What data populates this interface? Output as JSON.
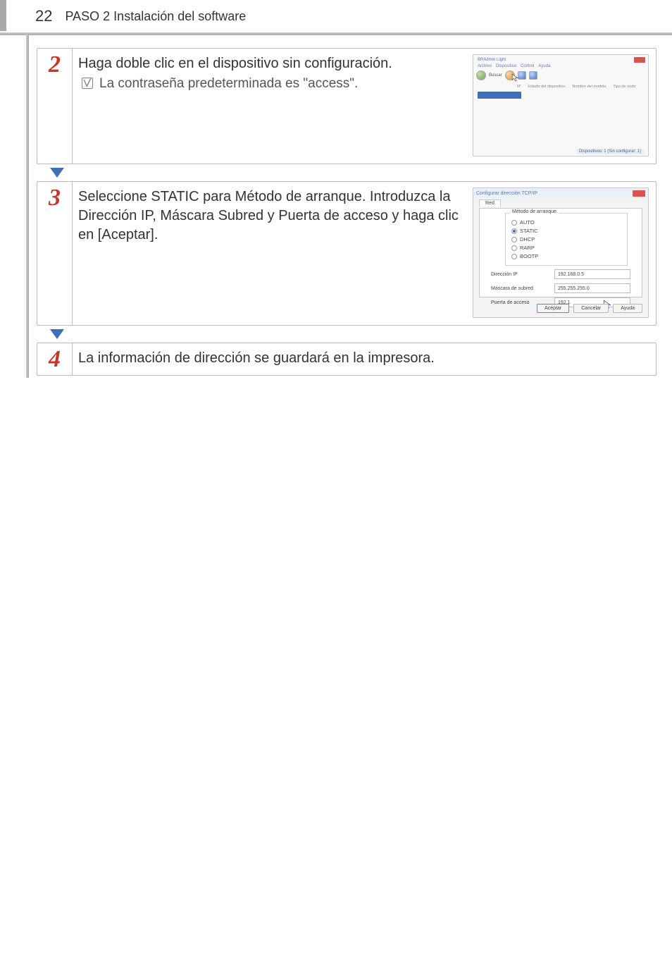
{
  "page": {
    "number": "22",
    "breadcrumb": "PASO 2 Instalación del software"
  },
  "steps": [
    {
      "num": "2",
      "text": "Haga doble clic en el dispositivo sin configuración.",
      "note": "La contraseña predeterminada es \"access\"."
    },
    {
      "num": "3",
      "text": "Seleccione STATIC para Método de arranque. Introduzca la Dirección IP, Máscara Subred y Puerta de acceso y haga clic en [Aceptar]."
    },
    {
      "num": "4",
      "text": "La información de dirección se guardará en la impresora."
    }
  ],
  "thumb1": {
    "window_title": "BRAdmin Light",
    "menu": [
      "Archivo",
      "Dispositivo",
      "Control",
      "Ayuda"
    ],
    "toolbar_label": "Buscar",
    "headers": [
      "IP",
      "Estado del dispositivo",
      "Nombre del modelo",
      "Tipo de nodo"
    ],
    "status": "Dispositivos: 1 (Sin configurar: 1)"
  },
  "thumb2": {
    "title": "Configurar dirección TCP/IP",
    "tab": "Red",
    "group": "Método de arranque",
    "radios": [
      "AUTO",
      "STATIC",
      "DHCP",
      "RARP",
      "BOOTP"
    ],
    "radio_selected": "STATIC",
    "fields": {
      "ip_label": "Dirección IP",
      "ip_value": "192.168.0.5",
      "mask_label": "Máscara de subred",
      "mask_value": "255.255.255.0",
      "gw_label": "Puerta de acceso",
      "gw_value": "192.1"
    },
    "buttons": {
      "ok": "Aceptar",
      "cancel": "Cancelar",
      "help": "Ayuda"
    }
  }
}
